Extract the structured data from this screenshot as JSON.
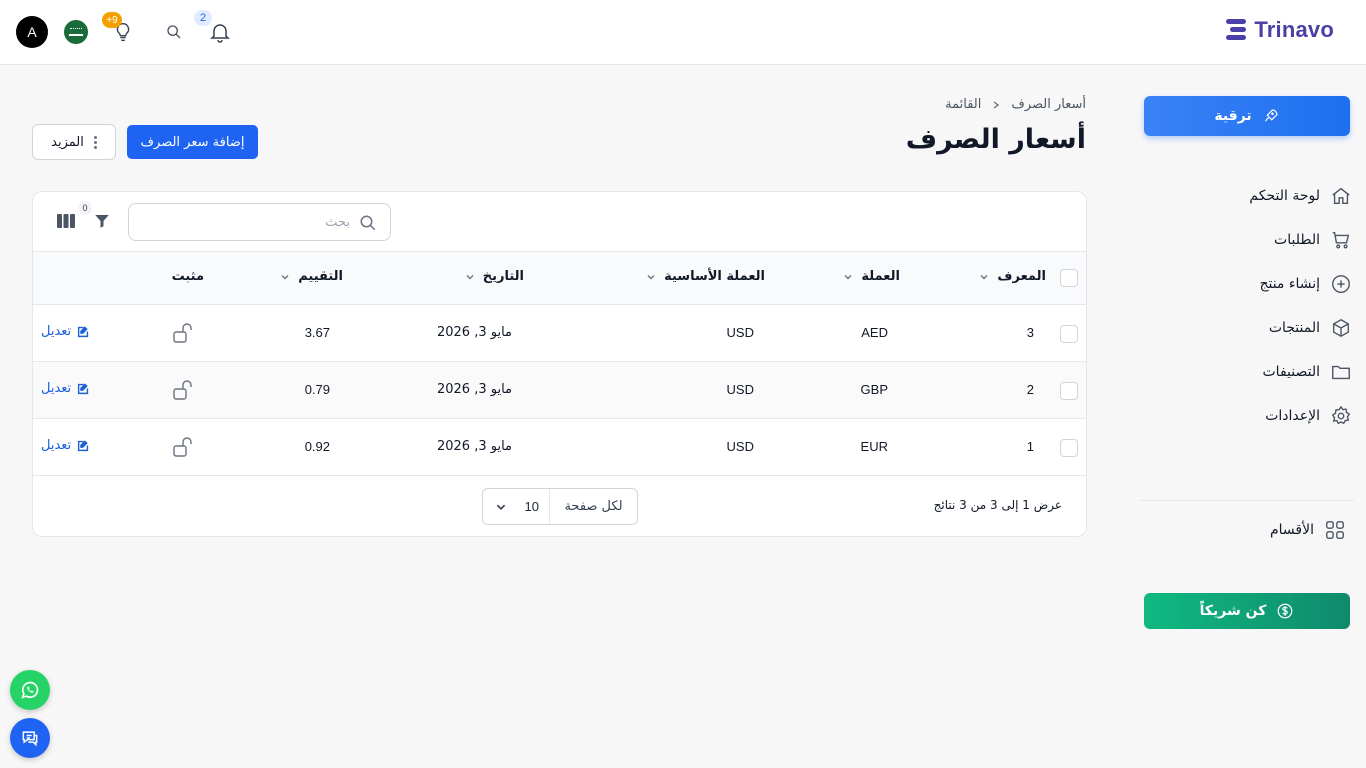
{
  "topbar": {
    "brand": "Trinavo",
    "avatar_initial": "A",
    "ideas_badge": "+9",
    "notifications_badge": "2"
  },
  "sidebar": {
    "upgrade_label": "ترقية",
    "items": [
      {
        "label": "لوحة التحكم",
        "icon": "home-icon"
      },
      {
        "label": "الطلبات",
        "icon": "cart-icon"
      },
      {
        "label": "إنشاء منتج",
        "icon": "plus-circle-icon"
      },
      {
        "label": "المنتجات",
        "icon": "box-icon"
      },
      {
        "label": "التصنيفات",
        "icon": "folder-icon"
      },
      {
        "label": "الإعدادات",
        "icon": "gear-icon"
      }
    ],
    "sections_label": "الأقسام",
    "partner_label": "كن شريكاً"
  },
  "header": {
    "breadcrumb": [
      "أسعار الصرف",
      "القائمة"
    ],
    "title": "أسعار الصرف",
    "add_button": "إضافة سعر الصرف",
    "more_button": "المزيد"
  },
  "table": {
    "search_placeholder": "بحث",
    "filter_count": "0",
    "columns": {
      "id": "المعرف",
      "currency": "العملة",
      "base_currency": "العملة الأساسية",
      "date": "التاريخ",
      "rate": "التقييم",
      "pinned": "مثبت"
    },
    "edit_label": "تعديل",
    "rows": [
      {
        "id": "3",
        "currency": "AED",
        "base": "USD",
        "date": "مايو 3, 2026",
        "rate": "3.67"
      },
      {
        "id": "2",
        "currency": "GBP",
        "base": "USD",
        "date": "مايو 3, 2026",
        "rate": "0.79"
      },
      {
        "id": "1",
        "currency": "EUR",
        "base": "USD",
        "date": "مايو 3, 2026",
        "rate": "0.92"
      }
    ],
    "footer_summary": "عرض 1 إلى 3 من 3 نتائج",
    "per_page_label": "لكل صفحة",
    "per_page_value": "10"
  },
  "colors": {
    "primary": "#1e63f2",
    "brand": "#4b3fa8",
    "partner": "#10b981",
    "whatsapp": "#25d366"
  }
}
